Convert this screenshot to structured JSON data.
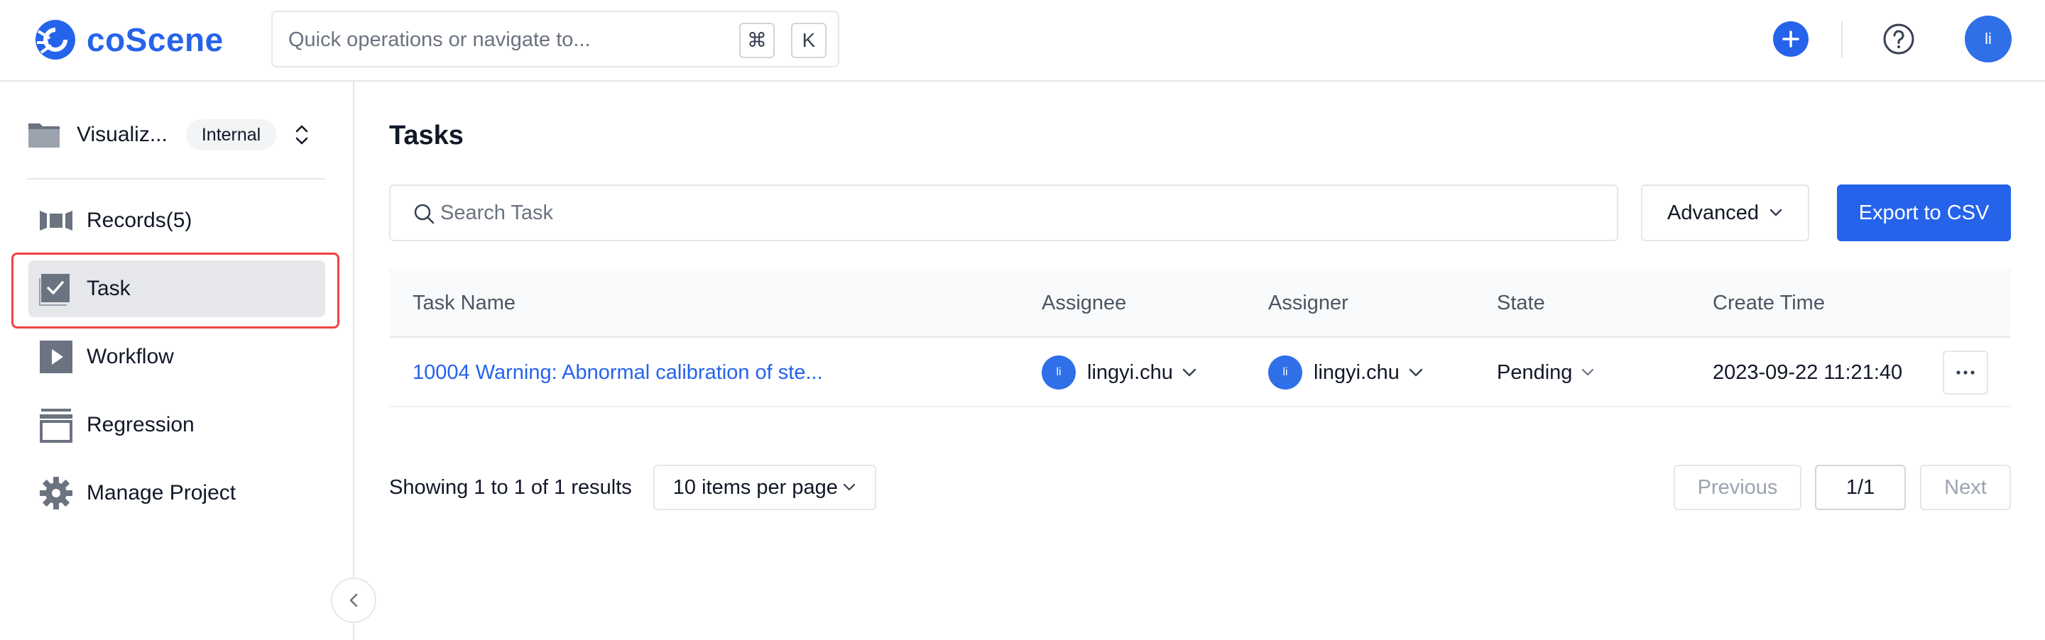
{
  "topbar": {
    "logo_text": "coScene",
    "quick_search_placeholder": "Quick operations or navigate to...",
    "kbd_cmd": "⌘",
    "kbd_k": "K",
    "user_initials": "li"
  },
  "sidebar": {
    "project_name": "Visualiz...",
    "project_badge": "Internal",
    "items": [
      {
        "label": "Records(5)",
        "icon": "records-icon"
      },
      {
        "label": "Task",
        "icon": "task-check-icon",
        "active": true
      },
      {
        "label": "Workflow",
        "icon": "play-icon"
      },
      {
        "label": "Regression",
        "icon": "archive-icon"
      },
      {
        "label": "Manage Project",
        "icon": "gear-icon"
      }
    ]
  },
  "main": {
    "title": "Tasks",
    "search_placeholder": "Search Task",
    "advanced_label": "Advanced",
    "export_label": "Export to CSV",
    "table": {
      "headers": [
        "Task Name",
        "Assignee",
        "Assigner",
        "State",
        "Create Time"
      ],
      "rows": [
        {
          "task_name": "10004 Warning: Abnormal calibration of ste...",
          "assignee": "lingyi.chu",
          "assignee_initials": "li",
          "assigner": "lingyi.chu",
          "assigner_initials": "li",
          "state": "Pending",
          "create_time": "2023-09-22 11:21:40"
        }
      ]
    },
    "pagination": {
      "showing": "Showing 1 to 1 of 1 results",
      "per_page": "10 items per page",
      "previous": "Previous",
      "page": "1/1",
      "next": "Next"
    }
  },
  "colors": {
    "accent": "#2563eb",
    "highlight": "#ef4444",
    "active_bg": "#e5e7eb"
  }
}
